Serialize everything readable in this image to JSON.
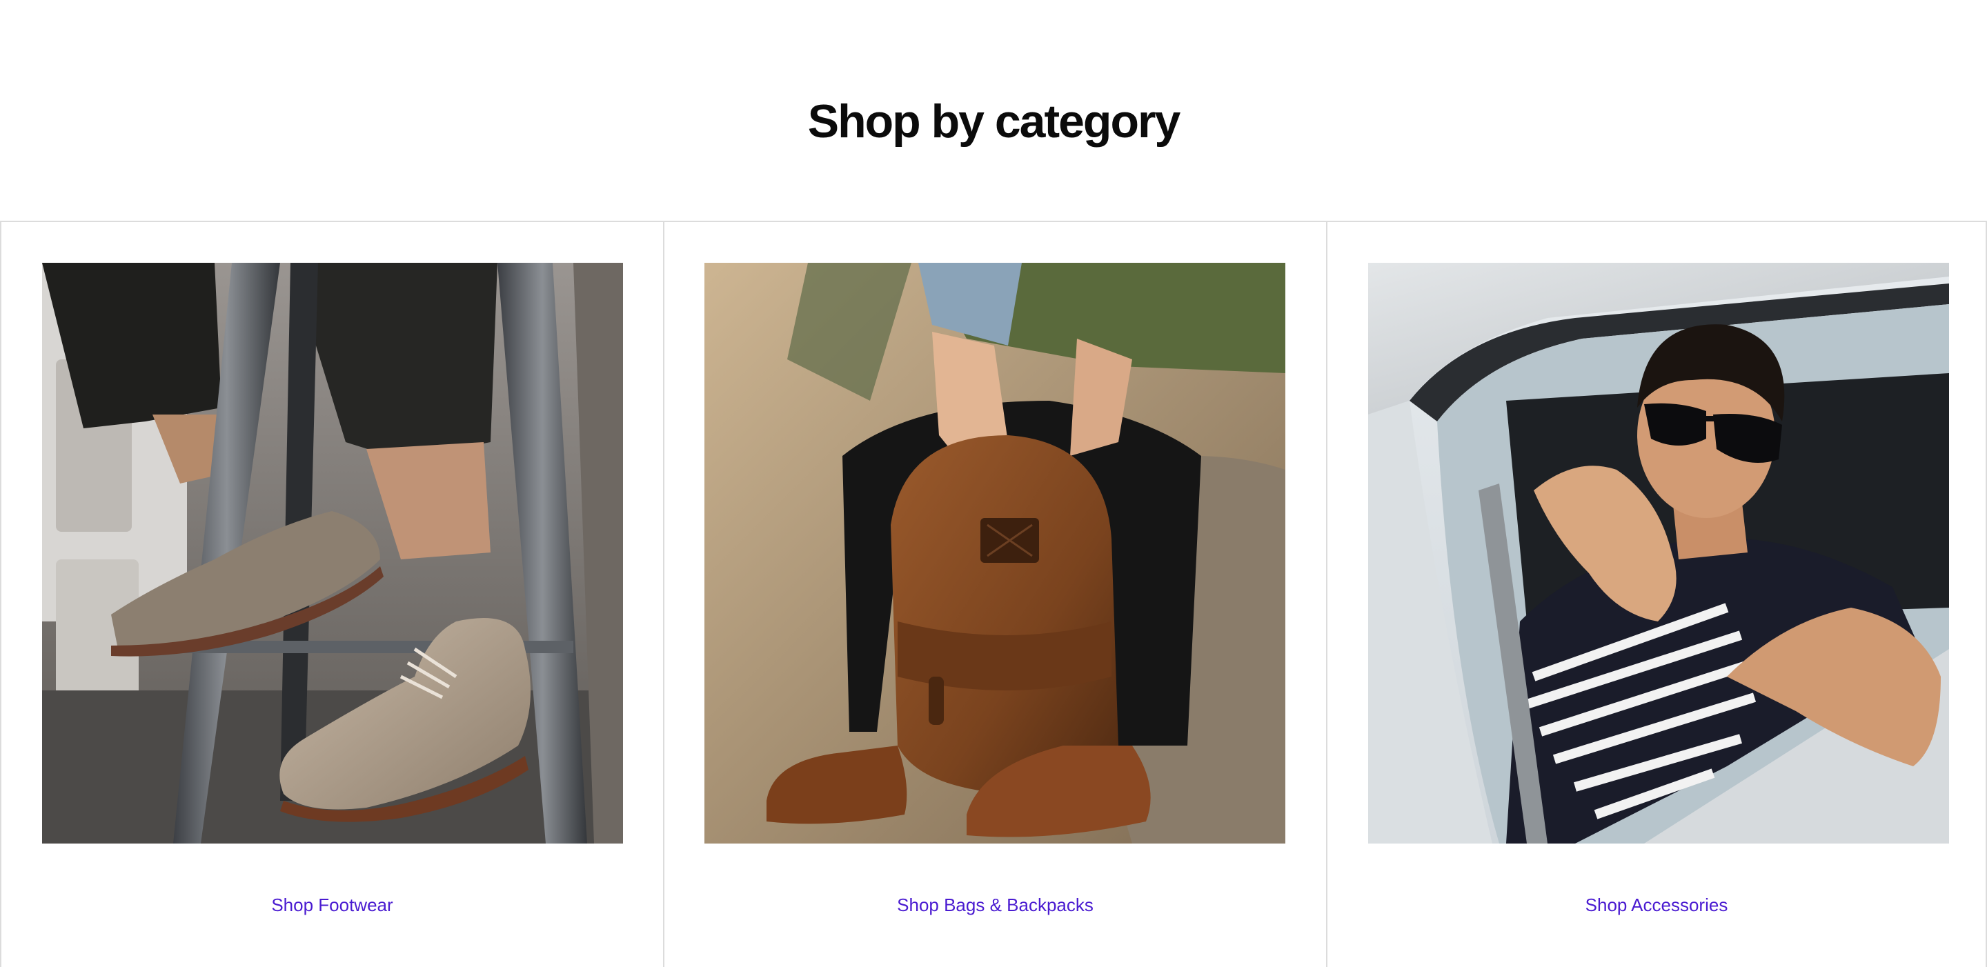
{
  "heading": "Shop by category",
  "categories": [
    {
      "label": "Shop Footwear",
      "image_icon": "footwear-photo"
    },
    {
      "label": "Shop Bags & Backpacks",
      "image_icon": "backpack-photo"
    },
    {
      "label": "Shop Accessories",
      "image_icon": "sunglasses-photo"
    }
  ],
  "colors": {
    "link": "#4a1bd1",
    "heading": "#0b0b0b",
    "divider": "#dcdcdc",
    "background": "#ffffff"
  }
}
